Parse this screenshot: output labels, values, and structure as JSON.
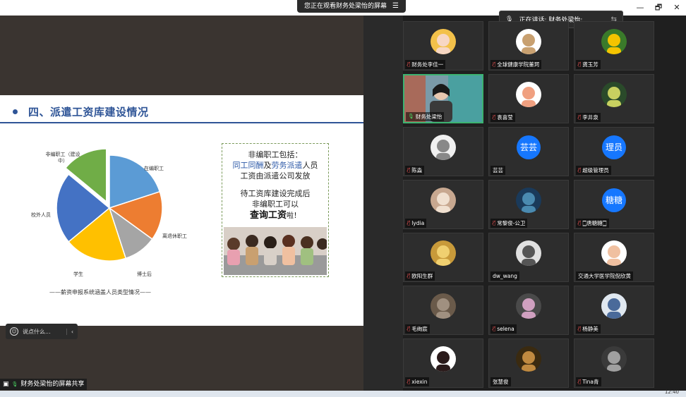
{
  "topbar": {
    "share_notice": "您正在观看财务处梁怡的屏幕",
    "menu_icon": "menu-icon",
    "window_controls": [
      "—",
      "🗗",
      "✕"
    ]
  },
  "speaking": {
    "label": "正在讲话: 财务处梁怡;"
  },
  "slide": {
    "title": "四、派遣工资库建设情况",
    "title_color": "#2f5597",
    "pie_labels": {
      "nonstaff": "非编职工（建设中）",
      "staff": "在编职工",
      "retired": "离退休职工",
      "postdoc": "博士后",
      "student": "学生",
      "external": "校外人员"
    },
    "caption": "——薪资申报系统涵盖人员类型情况——",
    "notice": {
      "line1": "非编职工包括：",
      "line2a": "同工同酬",
      "line2b": "及",
      "line2c": "劳务派遣",
      "line2d": "人员",
      "line3": "工资由派遣公司发放",
      "line4": "待工资库建设完成后",
      "line5": "非编职工可以",
      "line6a": "查询工资",
      "line6b": "啦！"
    }
  },
  "chart_data": {
    "type": "pie",
    "categories": [
      "非编职工（建设中）",
      "在编职工",
      "离退休职工",
      "博士后",
      "学生",
      "校外人员"
    ],
    "values": [
      14,
      20,
      15,
      10,
      19,
      22
    ],
    "colors": [
      "#70ad47",
      "#5b9bd5",
      "#ed7d31",
      "#a5a5a5",
      "#ffc000",
      "#4472c4"
    ],
    "exploded": "非编职工（建设中）"
  },
  "comment": {
    "placeholder": "说点什么..."
  },
  "share_status": "财务处梁怡的屏幕共享",
  "participants": [
    {
      "name": "财务处李佳一",
      "mic": "muted",
      "avatar": "cartoon-girl"
    },
    {
      "name": "全球健康学院董珂",
      "mic": "muted",
      "avatar": "cartoon-bear"
    },
    {
      "name": "龚玉芳",
      "mic": "muted",
      "avatar": "sunflower"
    },
    {
      "name": "财务处梁怡",
      "mic": "on",
      "avatar": "video"
    },
    {
      "name": "袁喜莹",
      "mic": "muted",
      "avatar": "cartoon-kid"
    },
    {
      "name": "李井泉",
      "mic": "muted",
      "avatar": "plant"
    },
    {
      "name": "陈淼",
      "mic": "muted",
      "avatar": "sketch"
    },
    {
      "name": "芸芸",
      "mic": "none",
      "avatar_text": "芸芸"
    },
    {
      "name": "超级管理员",
      "mic": "muted",
      "avatar_text": "理员"
    },
    {
      "name": "lydia",
      "mic": "muted",
      "avatar": "cat"
    },
    {
      "name": "常黎俊-公卫",
      "mic": "muted",
      "avatar": "ocean"
    },
    {
      "name": "🀆唐糖糖🀆",
      "mic": "muted",
      "avatar_text": "糖糖"
    },
    {
      "name": "欧阳生群",
      "mic": "muted",
      "avatar": "dog"
    },
    {
      "name": "dw_wang",
      "mic": "none",
      "avatar": "masked-man"
    },
    {
      "name": "交通大学医学院倪欣黄",
      "mic": "none",
      "avatar": "cartoon-baby"
    },
    {
      "name": "毛绚宸",
      "mic": "muted",
      "avatar": "blur"
    },
    {
      "name": "selena",
      "mic": "muted",
      "avatar": "figures"
    },
    {
      "name": "杨静美",
      "mic": "muted",
      "avatar": "couple"
    },
    {
      "name": "xiexin",
      "mic": "muted",
      "avatar": "girl-photo"
    },
    {
      "name": "张慧俊",
      "mic": "none",
      "avatar": "puppy"
    },
    {
      "name": "Tina青",
      "mic": "muted",
      "avatar": "portrait"
    }
  ],
  "taskbar": {
    "clock": "12:40"
  }
}
